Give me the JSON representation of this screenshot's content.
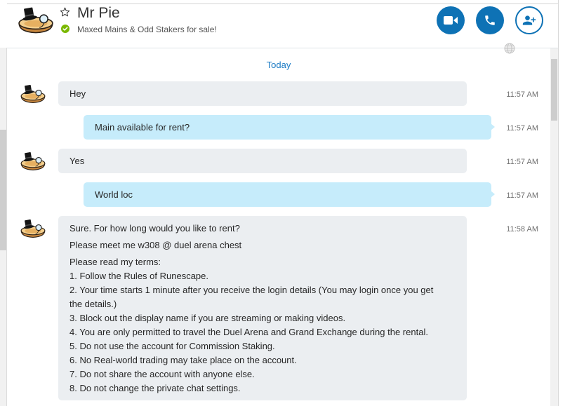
{
  "header": {
    "contact_name": "Mr Pie",
    "mood_message": "Maxed Mains & Odd Stakers for sale!",
    "avatar_icon": "pie-avatar-icon",
    "favorite_icon": "star-outline-icon",
    "presence_icon": "online-check-icon",
    "actions": [
      "video-camera-icon",
      "phone-icon",
      "add-person-icon"
    ]
  },
  "translator_icon": "globe-icon",
  "conversation": {
    "date_divider": "Today",
    "messages": [
      {
        "outgoing": false,
        "time": "11:57 AM",
        "paragraphs": [
          "Hey"
        ]
      },
      {
        "outgoing": true,
        "time": "11:57 AM",
        "paragraphs": [
          "Main available for rent?"
        ]
      },
      {
        "outgoing": false,
        "time": "11:57 AM",
        "paragraphs": [
          "Yes"
        ]
      },
      {
        "outgoing": true,
        "time": "11:57 AM",
        "paragraphs": [
          "World loc"
        ]
      },
      {
        "outgoing": false,
        "time": "11:58 AM",
        "paragraphs": [
          "Sure. For how long would you like to rent?",
          "Please meet me w308 @ duel arena chest"
        ],
        "list_intro": "Please read my terms:",
        "list": [
          "1. Follow the Rules of Runescape.",
          "2. Your time starts 1 minute after you receive the login details (You may login once you get the details.)",
          "3. Block out the display name if you are streaming or making videos.",
          "4. You are only permitted to travel the Duel Arena and Grand Exchange during the rental.",
          "5. Do not use the account for Commission Staking.",
          "6. No Real-world trading may take place on the account.",
          "7. Do not share the account with anyone else.",
          "8. Do not change the private chat settings."
        ]
      }
    ]
  },
  "colors": {
    "accent": "#0e72b5",
    "date_divider": "#1a7ac4",
    "presence_online": "#7ab800",
    "incoming_bubble": "#ebeef1",
    "outgoing_bubble": "#c6ecfb",
    "timestamp": "#707070"
  }
}
